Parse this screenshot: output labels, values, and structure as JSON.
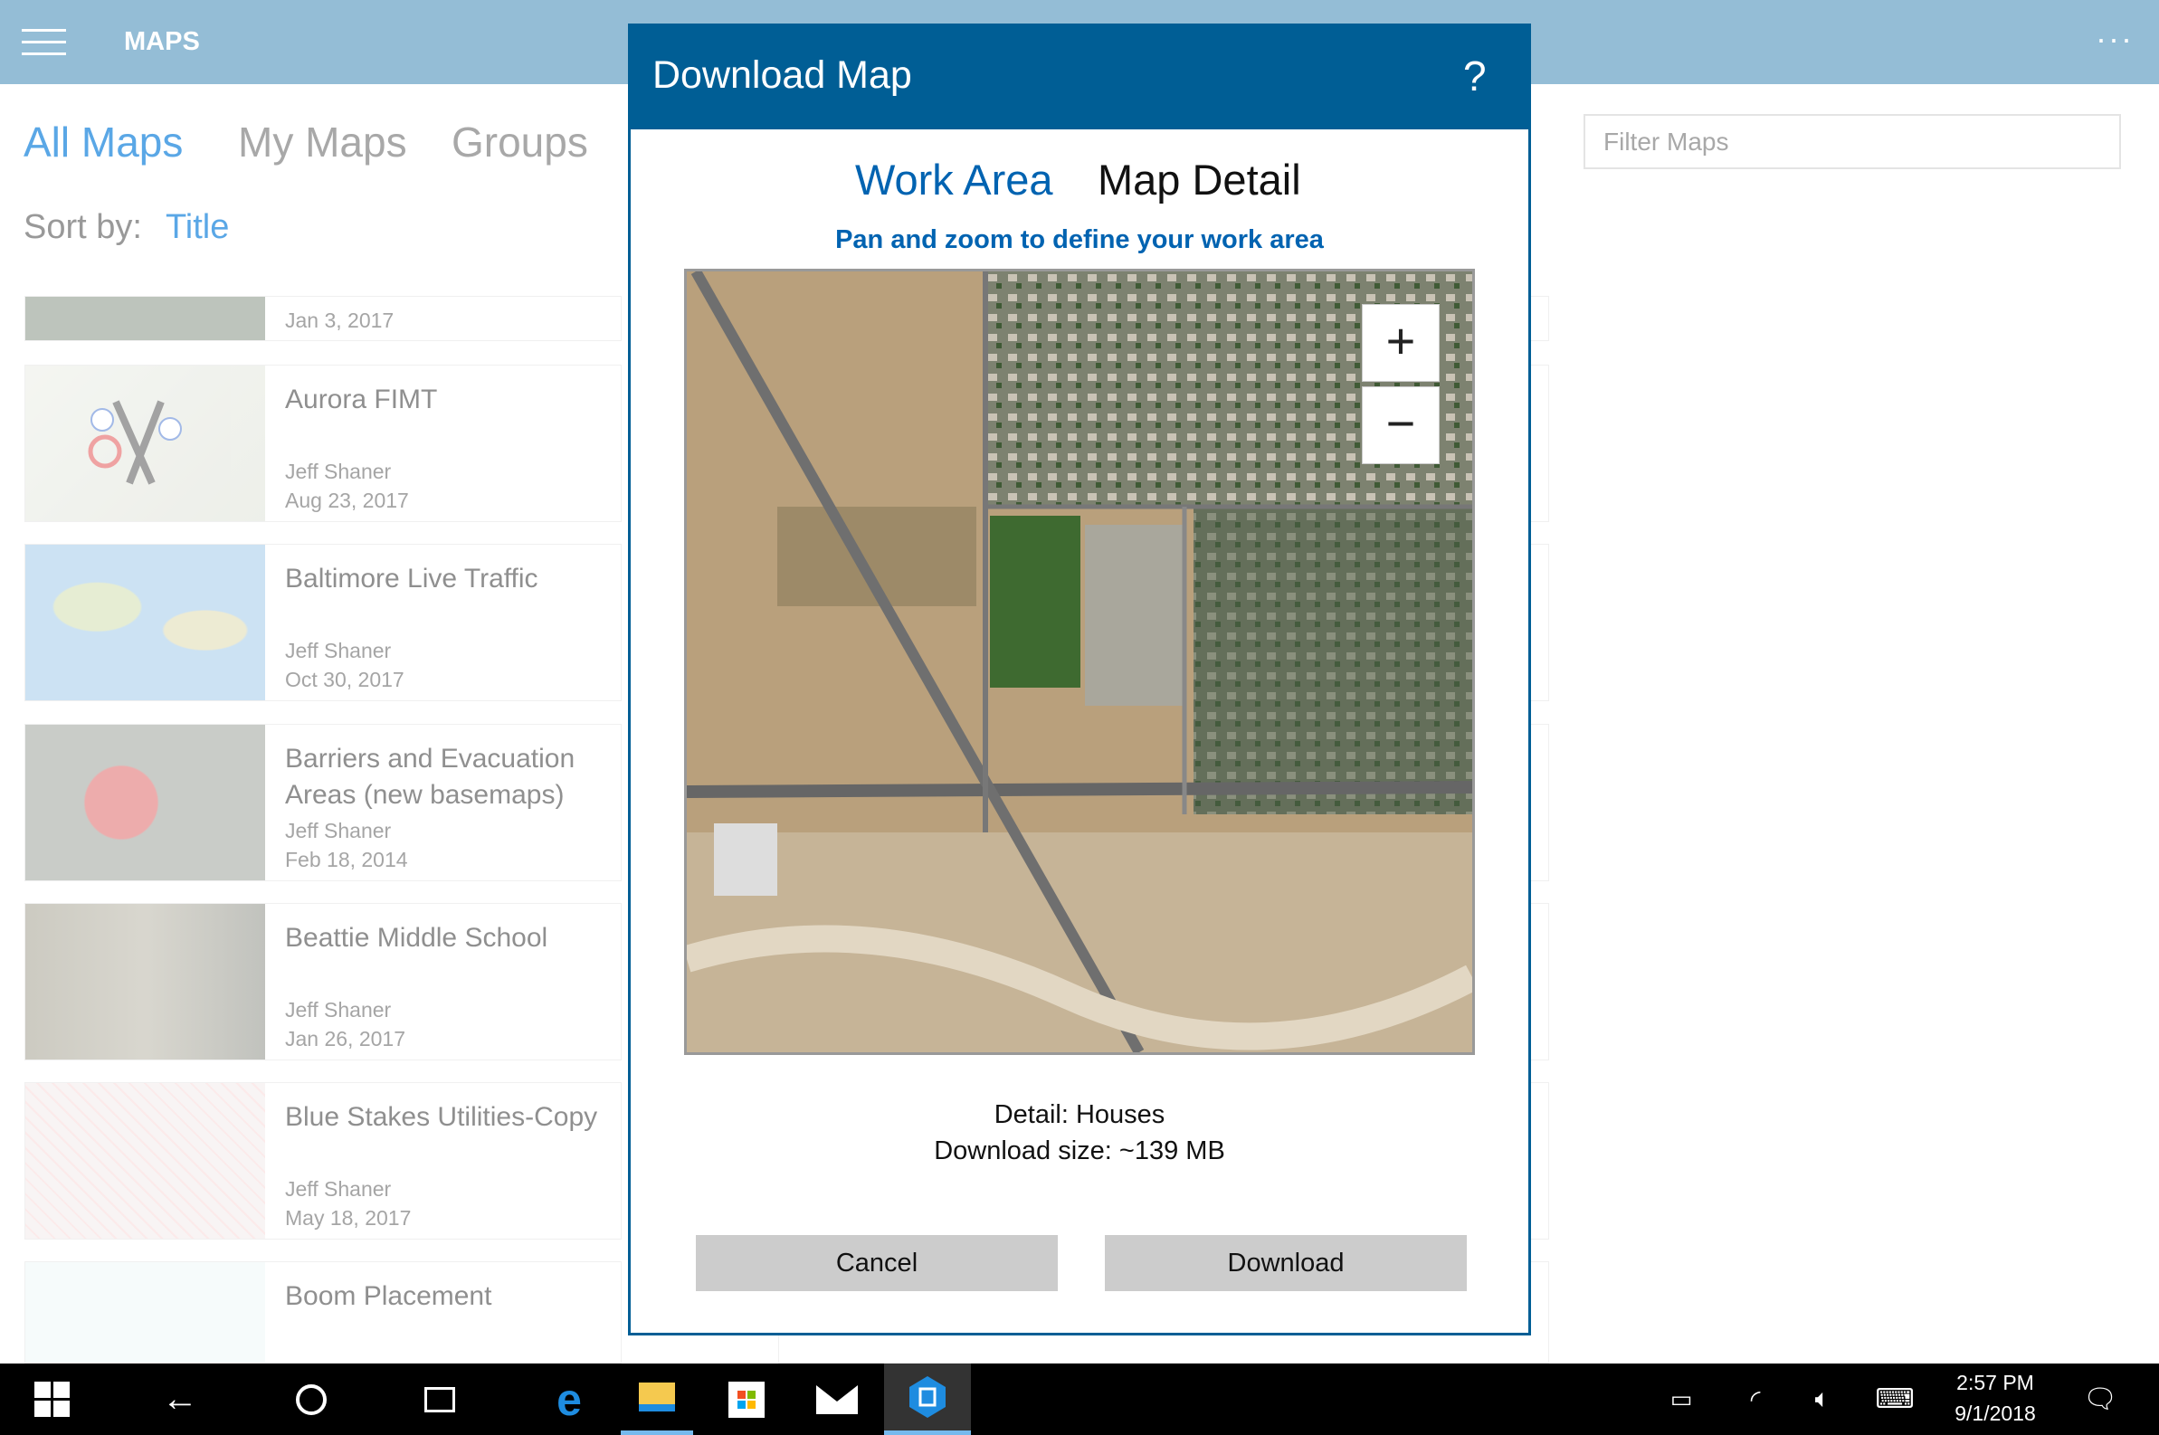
{
  "app": {
    "title": "MAPS",
    "more": "···"
  },
  "tabs": [
    {
      "label": "All Maps",
      "active": true
    },
    {
      "label": "My Maps"
    },
    {
      "label": "Groups"
    }
  ],
  "sort": {
    "label": "Sort by:",
    "value": "Title"
  },
  "filter": {
    "placeholder": "Filter Maps"
  },
  "maps": [
    {
      "title": "",
      "author": "",
      "date": "Jan 3, 2017"
    },
    {
      "title": "Aurora FIMT",
      "author": "Jeff Shaner",
      "date": "Aug 23, 2017"
    },
    {
      "title": "Baltimore Live Traffic",
      "author": "Jeff Shaner",
      "date": "Oct 30, 2017"
    },
    {
      "title": "Barriers and Evacuation Areas (new basemaps)",
      "author": "Jeff Shaner",
      "date": "Feb 18, 2014"
    },
    {
      "title": "Beattie Middle School",
      "author": "Jeff Shaner",
      "date": "Jan 26, 2017"
    },
    {
      "title": "Blue Stakes Utilities-Copy",
      "author": "Jeff Shaner",
      "date": "May 18, 2017"
    },
    {
      "title": "Boom Placement",
      "author": "",
      "date": ""
    }
  ],
  "dialog": {
    "title": "Download Map",
    "help": "?",
    "tabs": [
      {
        "label": "Work Area",
        "active": true
      },
      {
        "label": "Map Detail"
      }
    ],
    "instruction": "Pan and zoom to define your work area",
    "zoom_in": "+",
    "zoom_out": "−",
    "detail": "Detail: Houses",
    "size": "Download size: ~139 MB",
    "cancel": "Cancel",
    "download": "Download"
  },
  "taskbar": {
    "time": "2:57 PM",
    "date": "9/1/2018"
  },
  "colors": {
    "accent": "#0078d7",
    "dialog_header": "#005e95",
    "topbar": "#2b7bb3"
  }
}
